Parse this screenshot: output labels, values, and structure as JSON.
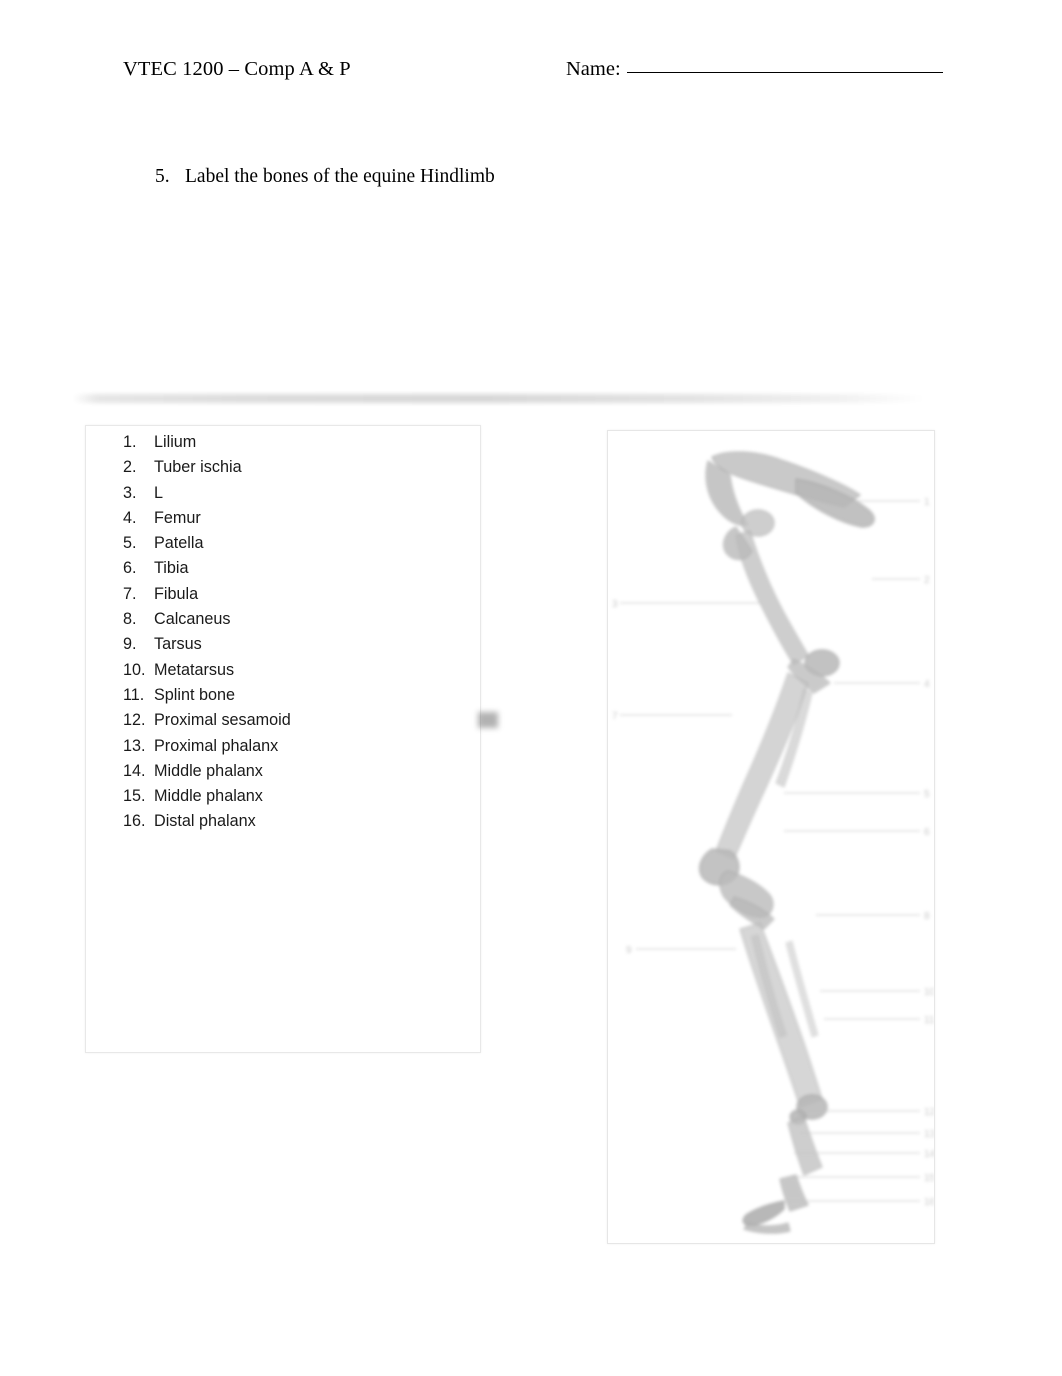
{
  "header": {
    "course": "VTEC 1200 – Comp A & P",
    "name_label": "Name:",
    "name_value": ""
  },
  "question": {
    "number": "5.",
    "text": "Label the bones of the equine Hindlimb"
  },
  "answer_list": {
    "items": [
      {
        "num": "1.",
        "label": "Lilium"
      },
      {
        "num": "2.",
        "label": "Tuber ischia"
      },
      {
        "num": "3.",
        "label": "L"
      },
      {
        "num": "4.",
        "label": "Femur"
      },
      {
        "num": "5.",
        "label": "Patella"
      },
      {
        "num": "6.",
        "label": "Tibia"
      },
      {
        "num": "7.",
        "label": "Fibula"
      },
      {
        "num": "8.",
        "label": "Calcaneus"
      },
      {
        "num": "9.",
        "label": "Tarsus"
      },
      {
        "num": "10.",
        "label": "Metatarsus"
      },
      {
        "num": "11.",
        "label": "Splint bone"
      },
      {
        "num": "12.",
        "label": "Proximal sesamoid"
      },
      {
        "num": "13.",
        "label": "Proximal phalanx"
      },
      {
        "num": "14.",
        "label": "Middle phalanx"
      },
      {
        "num": "15.",
        "label": "Middle phalanx"
      },
      {
        "num": "16.",
        "label": "Distal phalanx"
      }
    ]
  },
  "figure": {
    "name": "equine-hindlimb-skeleton-diagram",
    "description": "Faded anatomical line drawing of an equine hindlimb skeleton with leader lines to numbered callouts"
  },
  "colors": {
    "text": "#000000",
    "list_text": "#1a1a1a",
    "panel_border": "#e8e8e8",
    "figure_ink": "#8a8a8a",
    "page_background": "#ffffff"
  }
}
